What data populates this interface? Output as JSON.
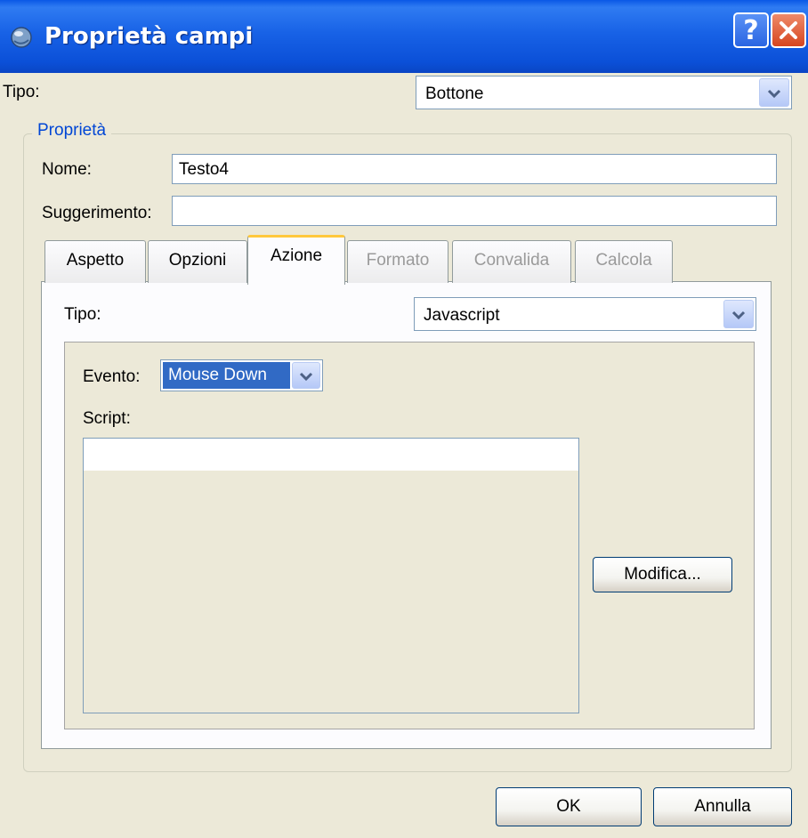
{
  "window": {
    "title": "Proprietà campi",
    "help_label": "?",
    "close_label": "✕"
  },
  "top": {
    "tipo_label": "Tipo:",
    "tipo_value": "Bottone"
  },
  "properties": {
    "group_label": "Proprietà",
    "nome_label": "Nome:",
    "nome_value": "Testo4",
    "suggerimento_label": "Suggerimento:",
    "suggerimento_value": ""
  },
  "tabs": [
    {
      "label": "Aspetto",
      "state": "normal"
    },
    {
      "label": "Opzioni",
      "state": "normal"
    },
    {
      "label": "Azione",
      "state": "active"
    },
    {
      "label": "Formato",
      "state": "disabled"
    },
    {
      "label": "Convalida",
      "state": "disabled"
    },
    {
      "label": "Calcola",
      "state": "disabled"
    }
  ],
  "action": {
    "tipo_label": "Tipo:",
    "tipo_value": "Javascript",
    "evento_label": "Evento:",
    "evento_value": "Mouse Down",
    "script_label": "Script:",
    "script_value": "",
    "modifica_label": "Modifica..."
  },
  "buttons": {
    "ok_label": "OK",
    "cancel_label": "Annulla"
  },
  "colors": {
    "titlebar": "#0a58e6",
    "accent_text": "#0046d5",
    "active_tab_border": "#ffc83c",
    "selection": "#316ac5"
  }
}
